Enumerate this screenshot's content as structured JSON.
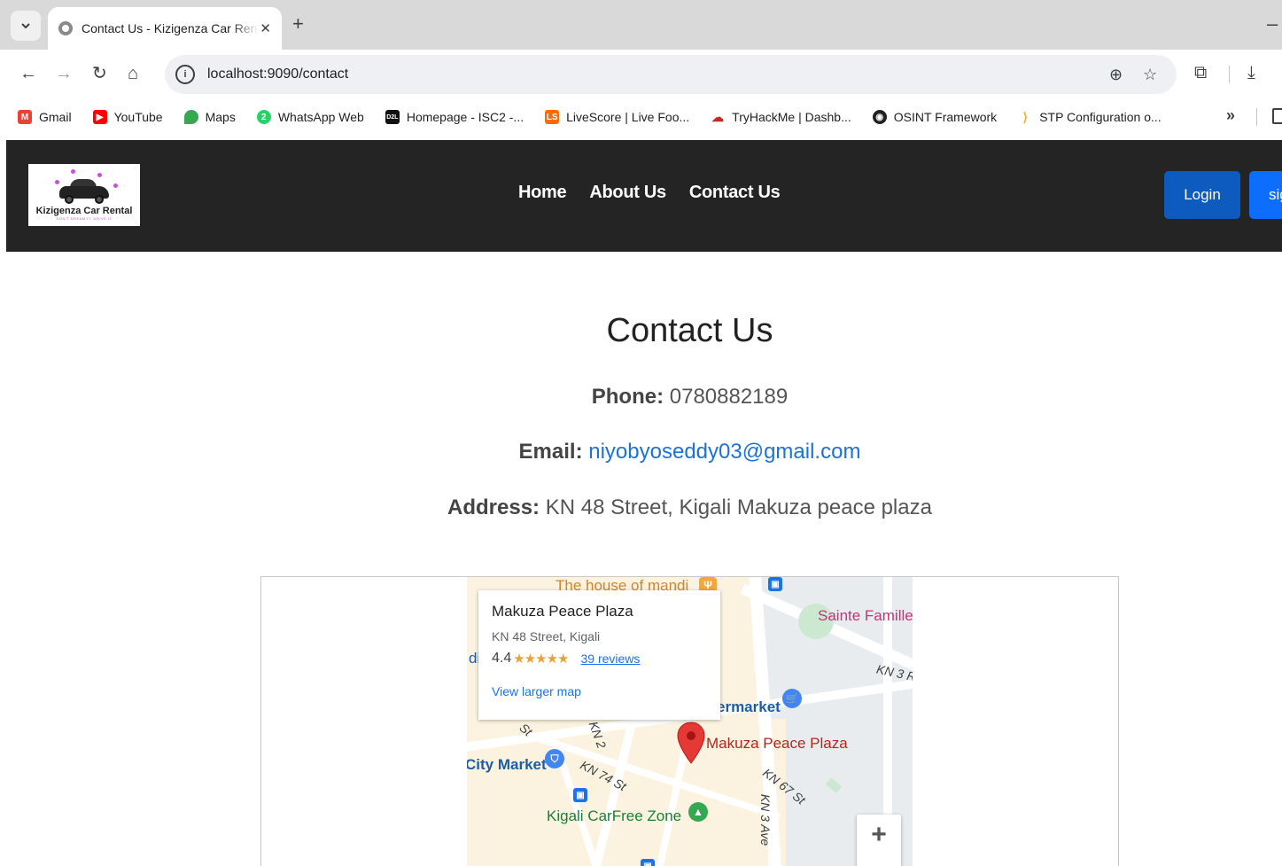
{
  "browser": {
    "tab_title": "Contact Us - Kizigenza Car Rental",
    "tab_close": "✕",
    "new_tab": "+",
    "minimize": "–",
    "url": "localhost:9090/contact",
    "bookmarks": [
      {
        "label": "Gmail",
        "icon": "gmail-icon",
        "color": "#ea4335"
      },
      {
        "label": "YouTube",
        "icon": "youtube-icon",
        "color": "#ff0000"
      },
      {
        "label": "Maps",
        "icon": "maps-icon",
        "color": "#34a853"
      },
      {
        "label": "WhatsApp Web",
        "icon": "whatsapp-icon",
        "color": "#25d366"
      },
      {
        "label": "Homepage - ISC2 -...",
        "icon": "d2l-icon",
        "color": "#111111"
      },
      {
        "label": "LiveScore | Live Foo...",
        "icon": "livescore-icon",
        "color": "#ff6a00"
      },
      {
        "label": "TryHackMe | Dashb...",
        "icon": "tryhackme-icon",
        "color": "#c62828"
      },
      {
        "label": "OSINT Framework",
        "icon": "osint-icon",
        "color": "#202124"
      },
      {
        "label": "STP Configuration o...",
        "icon": "stp-icon",
        "color": "#f2b01e"
      }
    ],
    "bookmarks_more": "»"
  },
  "site": {
    "logo_text": "Kizigenza Car Rental",
    "logo_tagline": "DON'T DREAM IT, DRIVE IT",
    "nav": [
      "Home",
      "About Us",
      "Contact Us"
    ],
    "login_label": "Login",
    "signup_label": "sig"
  },
  "contact": {
    "title": "Contact Us",
    "phone_label": "Phone:",
    "phone": "0780882189",
    "email_label": "Email:",
    "email": "niyobyoseddy03@gmail.com",
    "address_label": "Address:",
    "address": "KN 48 Street, Kigali Makuza peace plaza"
  },
  "map": {
    "place_name": "Makuza Peace Plaza",
    "place_address": "KN 48 Street, Kigali",
    "rating": "4.4",
    "stars": "★★★★★",
    "reviews": "39 reviews",
    "view_larger": "View larger map",
    "labels": {
      "house_of_mandi": "The house of mandi",
      "sainte_famille": "Sainte Famille",
      "kn3": "KN 3 R",
      "supermarket": "ermarket",
      "makuza": "Makuza Peace Plaza",
      "city_market": "City Market",
      "kn74": "KN 74 St",
      "kn2": "KN 2",
      "kn67": "KN 67 St",
      "kn3ave": "KN 3 Ave",
      "carfree": "Kigali CarFree Zone",
      "st": "St",
      "di": "di"
    },
    "zoom_in": "+",
    "pin_color": "#e53935"
  }
}
